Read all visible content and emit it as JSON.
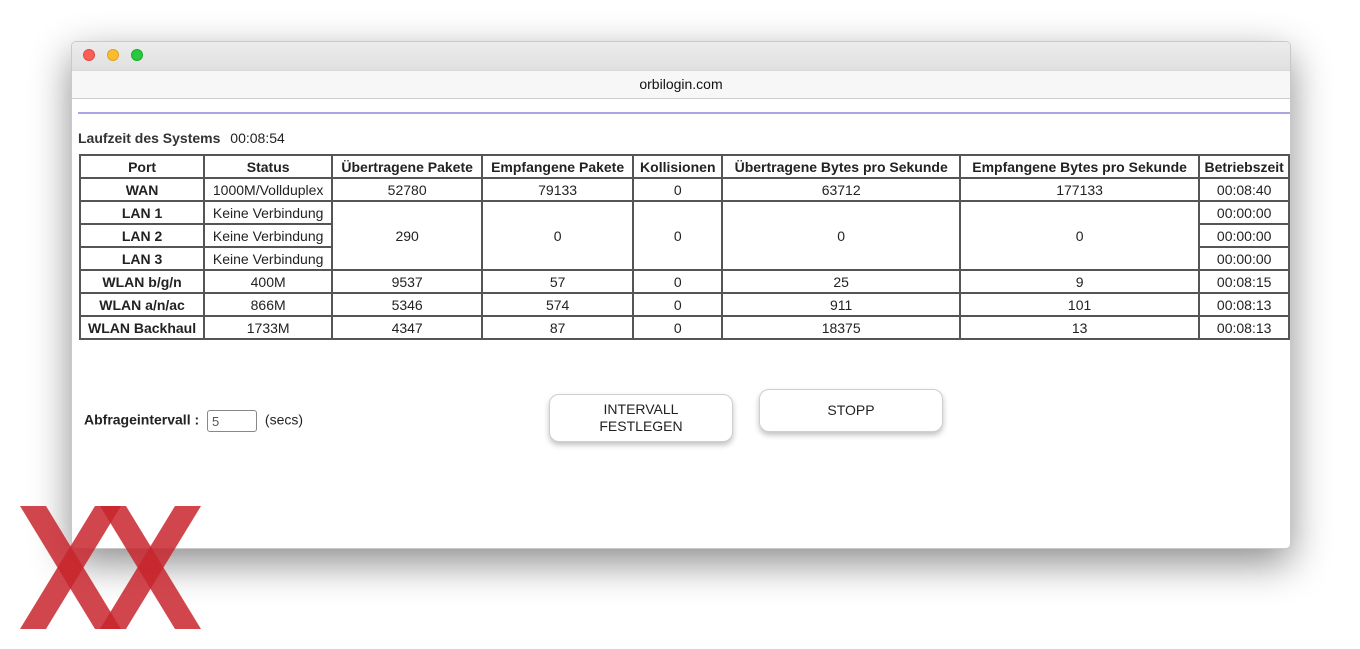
{
  "window": {
    "url": "orbilogin.com"
  },
  "uptime": {
    "label": "Laufzeit des Systems",
    "value": "00:08:54"
  },
  "table": {
    "headers": [
      "Port",
      "Status",
      "Übertragene Pakete",
      "Empfangene Pakete",
      "Kollisionen",
      "Übertragene Bytes pro Sekunde",
      "Empfangene Bytes pro Sekunde",
      "Betriebszeit"
    ],
    "rows": [
      {
        "port": "WAN",
        "status": "1000M/Vollduplex",
        "tx_packets": "52780",
        "rx_packets": "79133",
        "collisions": "0",
        "tx_bps": "63712",
        "rx_bps": "177133",
        "uptime": "00:08:40"
      },
      {
        "port": "LAN 1",
        "status": "Keine Verbindung",
        "uptime": "00:00:00"
      },
      {
        "port": "LAN 2",
        "status": "Keine Verbindung",
        "uptime": "00:00:00"
      },
      {
        "port": "LAN 3",
        "status": "Keine Verbindung",
        "uptime": "00:00:00"
      },
      {
        "port": "WLAN b/g/n",
        "status": "400M",
        "tx_packets": "9537",
        "rx_packets": "57",
        "collisions": "0",
        "tx_bps": "25",
        "rx_bps": "9",
        "uptime": "00:08:15"
      },
      {
        "port": "WLAN a/n/ac",
        "status": "866M",
        "tx_packets": "5346",
        "rx_packets": "574",
        "collisions": "0",
        "tx_bps": "911",
        "rx_bps": "101",
        "uptime": "00:08:13"
      },
      {
        "port": "WLAN Backhaul",
        "status": "1733M",
        "tx_packets": "4347",
        "rx_packets": "87",
        "collisions": "0",
        "tx_bps": "18375",
        "rx_bps": "13",
        "uptime": "00:08:13"
      }
    ],
    "lan_merged": {
      "tx_packets": "290",
      "rx_packets": "0",
      "collisions": "0",
      "tx_bps": "0",
      "rx_bps": "0"
    }
  },
  "interval": {
    "label": "Abfrageintervall :",
    "value": "5",
    "unit": "(secs)"
  },
  "buttons": {
    "set_interval": "INTERVALL\nFESTLEGEN",
    "stop": "STOPP"
  },
  "colors": {
    "watermark": "#c8262d",
    "accent_line": "#a9a6e0"
  },
  "watermark": {
    "icon": "xx-logo-icon"
  }
}
